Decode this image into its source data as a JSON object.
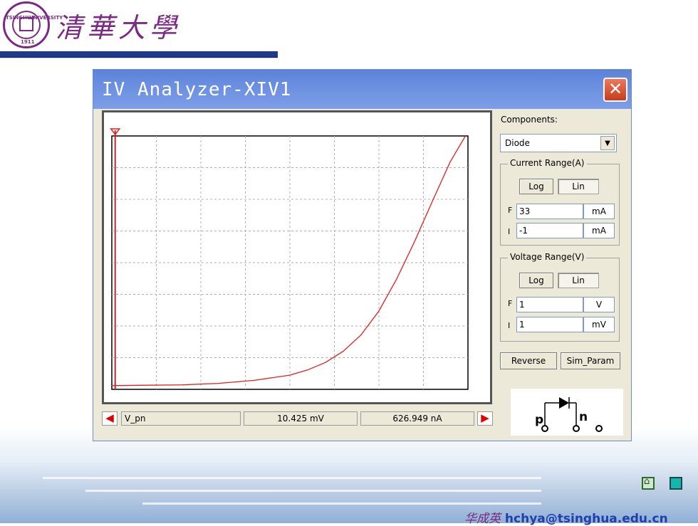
{
  "slide": {
    "university_name": "清華大學",
    "seal_text_left": "TSINGHUA",
    "seal_text_right": "UNIVERSITY",
    "seal_year": "1911",
    "footer_name": "华成英",
    "footer_email": "hchya@tsinghua.edu.cn",
    "colors": {
      "accent": "#7a2a84",
      "rule": "#1f3a8a",
      "footer": "#1f3fae"
    }
  },
  "window": {
    "title": "IV Analyzer-XIV1",
    "close_icon": "close-icon"
  },
  "sidebar": {
    "components_label": "Components:",
    "component_selected": "Diode",
    "current_range": {
      "title": "Current Range(A)",
      "log_label": "Log",
      "lin_label": "Lin",
      "f_label": "F",
      "f_value": "33",
      "f_unit": "mA",
      "i_label": "I",
      "i_value": "-1",
      "i_unit": "mA"
    },
    "voltage_range": {
      "title": "Voltage Range(V)",
      "log_label": "Log",
      "lin_label": "Lin",
      "f_label": "F",
      "f_value": "1",
      "f_unit": "V",
      "i_label": "I",
      "i_value": "1",
      "i_unit": "mV"
    },
    "reverse_label": "Reverse",
    "sim_param_label": "Sim_Param"
  },
  "status_bar": {
    "signal": "V_pn",
    "voltage_readout": "10.425 mV",
    "current_readout": "626.949 nA"
  },
  "diode_symbol": {
    "p_label": "p",
    "n_label": "n"
  },
  "chart_data": {
    "type": "line",
    "xlim": [
      0.001,
      1
    ],
    "ylim": [
      -1,
      33
    ],
    "grid": true,
    "cursor_x": 0.010425,
    "series": [
      {
        "color": "#e02020",
        "x": [
          0.001,
          0.1,
          0.2,
          0.3,
          0.4,
          0.5,
          0.55,
          0.6,
          0.65,
          0.7,
          0.75,
          0.8,
          0.85,
          0.9,
          0.95,
          0.993
        ],
        "y": [
          -0.5,
          -0.45,
          -0.4,
          -0.2,
          0.2,
          0.9,
          1.6,
          2.6,
          4.1,
          6.3,
          9.5,
          13.8,
          18.8,
          24.2,
          29.5,
          33.0
        ]
      }
    ]
  }
}
